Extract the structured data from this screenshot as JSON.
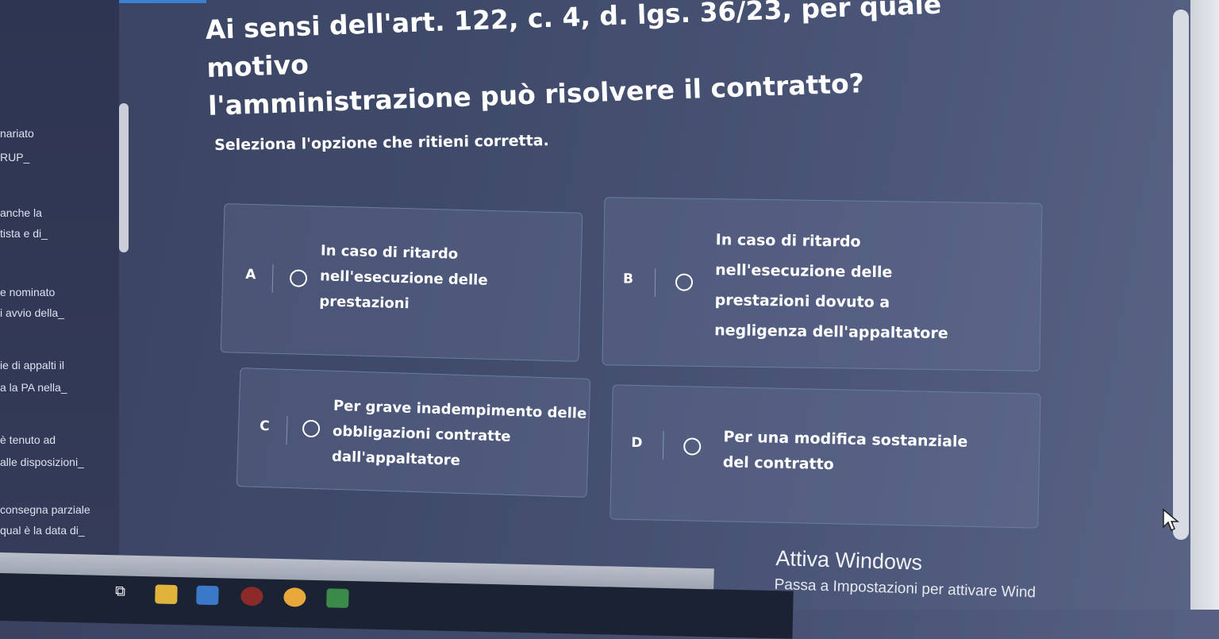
{
  "question": {
    "lines": [
      "Ai sensi dell'art. 122, c. 4, d. lgs. 36/23, per quale motivo",
      "l'amministrazione può risolvere il contratto?"
    ]
  },
  "instruction": "Seleziona l'opzione che ritieni corretta.",
  "sidebar": {
    "items": [
      "nariato",
      "RUP_",
      "anche la",
      "tista e di_",
      "e nominato",
      "i avvio della_",
      "ie di appalti il",
      "a la PA nella_",
      "è tenuto ad",
      "alle disposizioni_",
      "consegna parziale",
      "qual è la data di_"
    ]
  },
  "options": [
    {
      "letter": "A",
      "lines": [
        "In caso di ritardo",
        "nell'esecuzione delle",
        "prestazioni"
      ]
    },
    {
      "letter": "B",
      "lines": [
        "In caso di ritardo",
        "nell'esecuzione delle",
        "prestazioni dovuto a",
        "negligenza dell'appaltatore"
      ]
    },
    {
      "letter": "C",
      "lines": [
        "Per grave inadempimento delle",
        "obbligazioni contratte",
        "dall'appaltatore"
      ]
    },
    {
      "letter": "D",
      "lines": [
        "Per una modifica sostanziale",
        "del contratto"
      ]
    }
  ],
  "watermark": {
    "title": "Attiva Windows",
    "subtitle": "Passa a Impostazioni per attivare Wind"
  },
  "colors": {
    "background": "#3f4a6a",
    "option_border": "#6e7aa0",
    "text": "#ffffff"
  }
}
